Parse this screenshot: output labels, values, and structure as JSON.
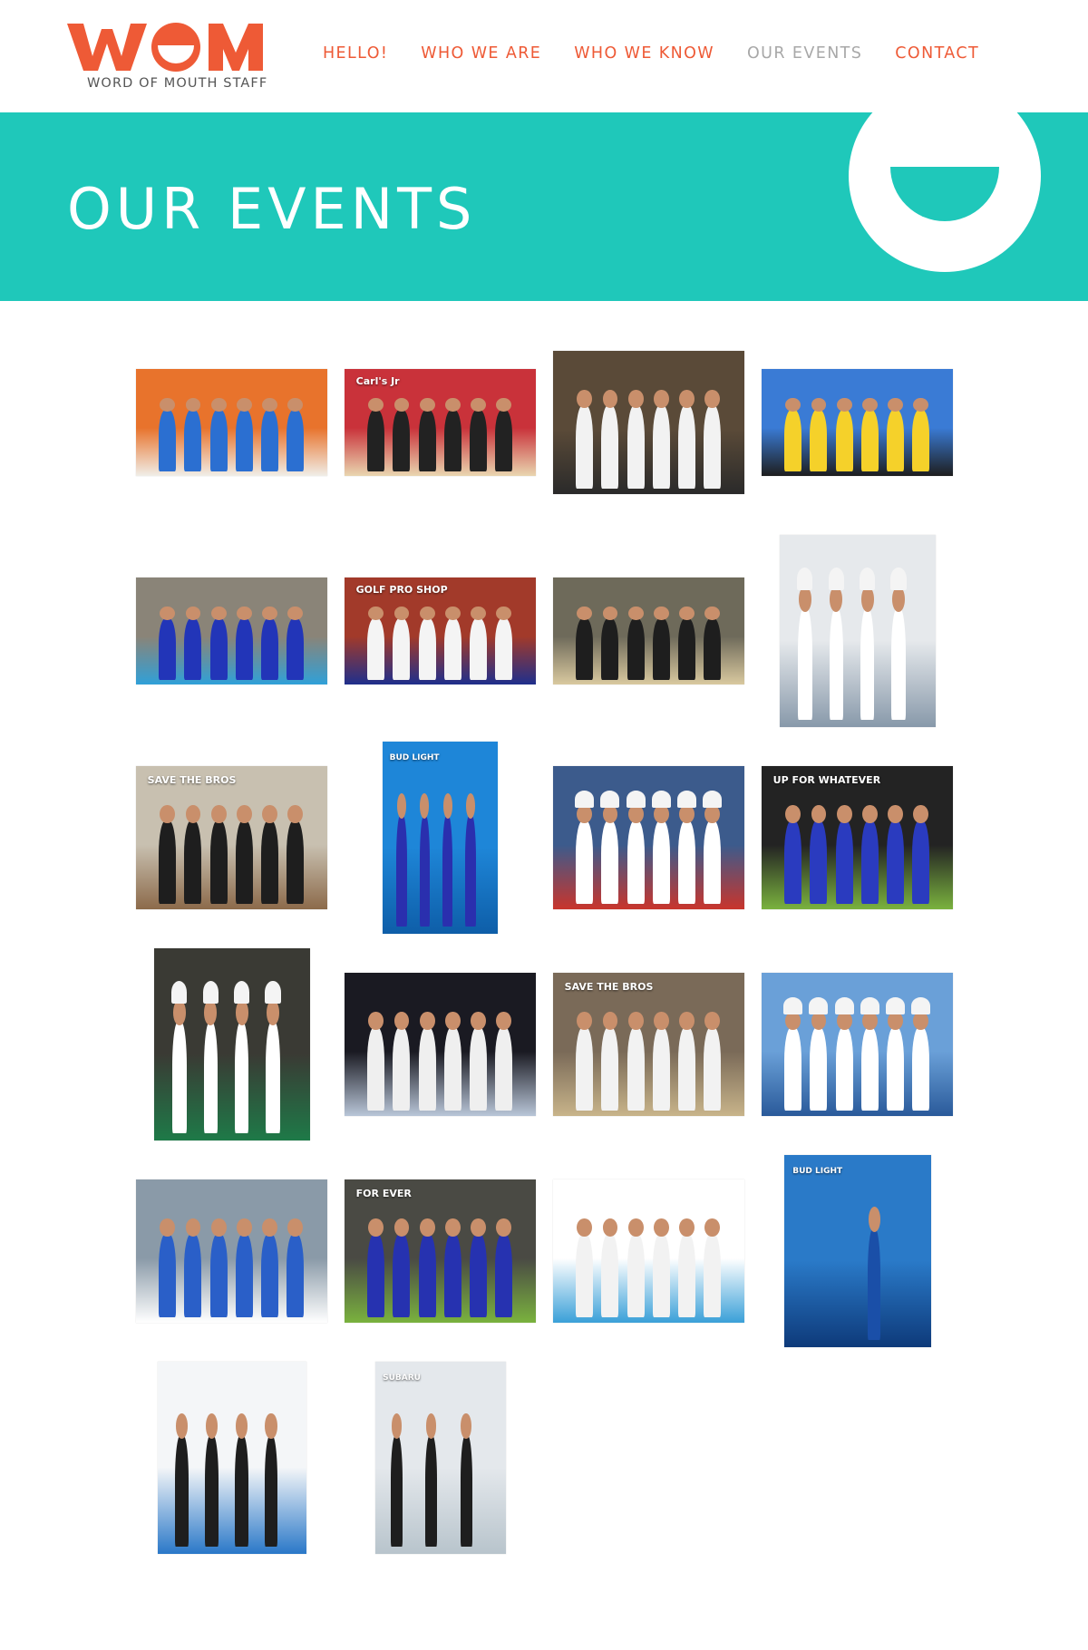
{
  "brand": {
    "logo_text": "WOM",
    "tagline": "WORD OF MOUTH STAFF",
    "accent_color": "#ee5a36",
    "banner_color": "#1fc8ba"
  },
  "nav": {
    "items": [
      {
        "label": "HELLO!",
        "active": false
      },
      {
        "label": "WHO WE ARE",
        "active": false
      },
      {
        "label": "WHO WE KNOW",
        "active": false
      },
      {
        "label": "OUR EVENTS",
        "active": true
      },
      {
        "label": "CONTACT",
        "active": false
      }
    ]
  },
  "banner": {
    "title": "OUR EVENTS"
  },
  "gallery": {
    "photos": [
      {
        "orientation": "landscape",
        "palette": [
          "#e8732c",
          "#2b6fd1",
          "#f0eee8"
        ],
        "scene": "crew",
        "caption": ""
      },
      {
        "orientation": "landscape",
        "palette": [
          "#c9323a",
          "#222222",
          "#e9d6b0"
        ],
        "scene": "truck",
        "caption": "Carl's Jr"
      },
      {
        "orientation": "landscape-tall",
        "palette": [
          "#5a4a38",
          "#f2f2f2",
          "#2a2a2a"
        ],
        "scene": "crew",
        "caption": ""
      },
      {
        "orientation": "landscape",
        "palette": [
          "#3a7bd5",
          "#f5d12a",
          "#1e1e1e"
        ],
        "scene": "star",
        "caption": ""
      },
      {
        "orientation": "landscape",
        "palette": [
          "#8a8478",
          "#2235b8",
          "#30a0d8"
        ],
        "scene": "crew",
        "caption": ""
      },
      {
        "orientation": "landscape",
        "palette": [
          "#a23a2a",
          "#f4f4f4",
          "#1f2f8c"
        ],
        "scene": "crew",
        "caption": "GOLF PRO SHOP"
      },
      {
        "orientation": "landscape",
        "palette": [
          "#6e6a5a",
          "#1e1e1e",
          "#d9c99f"
        ],
        "scene": "crew",
        "caption": ""
      },
      {
        "orientation": "portrait",
        "palette": [
          "#e6e9ec",
          "#ffffff",
          "#8899aa"
        ],
        "scene": "chefs",
        "caption": ""
      },
      {
        "orientation": "landscape-tall",
        "palette": [
          "#c8c0b0",
          "#1e1e1e",
          "#8c6a4a"
        ],
        "scene": "store",
        "caption": "SAVE THE BROS"
      },
      {
        "orientation": "portrait-tall",
        "palette": [
          "#1e86d8",
          "#2a2fae",
          "#0e5ea8"
        ],
        "scene": "crew",
        "caption": "BUD LIGHT"
      },
      {
        "orientation": "landscape-tall",
        "palette": [
          "#3c5b8c",
          "#ffffff",
          "#c9352c"
        ],
        "scene": "chefs",
        "caption": ""
      },
      {
        "orientation": "landscape-tall",
        "palette": [
          "#232323",
          "#2a3bbf",
          "#7ab23e"
        ],
        "scene": "sign",
        "caption": "UP FOR WHATEVER"
      },
      {
        "orientation": "portrait",
        "palette": [
          "#3a3a34",
          "#ffffff",
          "#1e7a48"
        ],
        "scene": "chefs",
        "caption": ""
      },
      {
        "orientation": "landscape-tall",
        "palette": [
          "#1a1a22",
          "#efefef",
          "#b9c6d8"
        ],
        "scene": "crew",
        "caption": ""
      },
      {
        "orientation": "landscape-tall",
        "palette": [
          "#7a6a58",
          "#f2f2f2",
          "#c8b48a"
        ],
        "scene": "store",
        "caption": "SAVE THE BROS"
      },
      {
        "orientation": "landscape-tall",
        "palette": [
          "#6aa0d8",
          "#ffffff",
          "#2a5a9a"
        ],
        "scene": "chefs",
        "caption": ""
      },
      {
        "orientation": "landscape-tall",
        "palette": [
          "#8a9aa8",
          "#2a5fc8",
          "#ffffff"
        ],
        "scene": "crew",
        "caption": ""
      },
      {
        "orientation": "landscape-tall",
        "palette": [
          "#4a4a44",
          "#2632b0",
          "#7ab23e"
        ],
        "scene": "sign",
        "caption": "FOR EVER"
      },
      {
        "orientation": "landscape-tall",
        "palette": [
          "#ffffff",
          "#f2f2f2",
          "#3aa0d8"
        ],
        "scene": "crew",
        "caption": ""
      },
      {
        "orientation": "portrait-narrow",
        "palette": [
          "#2a7ac8",
          "#1a4fa8",
          "#0e3a7a"
        ],
        "scene": "bottle",
        "caption": "BUD LIGHT"
      },
      {
        "orientation": "portrait-narrow",
        "palette": [
          "#f4f6f8",
          "#1e1e1e",
          "#2a78c8"
        ],
        "scene": "crew",
        "caption": ""
      },
      {
        "orientation": "portrait-small",
        "palette": [
          "#e4e8ec",
          "#1e1e1e",
          "#b8c4cc"
        ],
        "scene": "car",
        "caption": "SUBARU"
      }
    ]
  }
}
